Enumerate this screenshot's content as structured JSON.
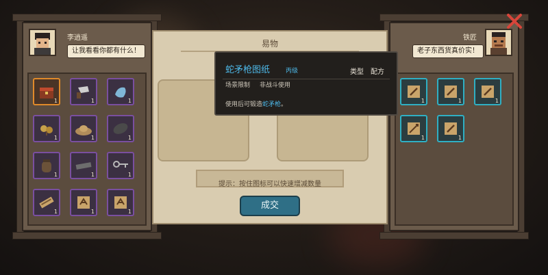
{
  "title": "易物",
  "left_npc": {
    "name": "李逍遥",
    "speech": "让我看看你都有什么！",
    "items": [
      {
        "icon": "treasure-chest-icon",
        "qty": "1",
        "rarity": "orange"
      },
      {
        "icon": "cleaver-icon",
        "qty": "1",
        "rarity": "purple"
      },
      {
        "icon": "blue-cloth-icon",
        "qty": "1",
        "rarity": "purple"
      },
      {
        "icon": "herb-icon",
        "qty": "1",
        "rarity": "purple"
      },
      {
        "icon": "straw-hat-icon",
        "qty": "1",
        "rarity": "purple"
      },
      {
        "icon": "black-leaf-icon",
        "qty": "1",
        "rarity": "purple"
      },
      {
        "icon": "jar-icon",
        "qty": "1",
        "rarity": "purple"
      },
      {
        "icon": "iron-bar-icon",
        "qty": "1",
        "rarity": "purple"
      },
      {
        "icon": "key-icon",
        "qty": "1",
        "rarity": "purple"
      },
      {
        "icon": "scroll-icon",
        "qty": "1",
        "rarity": "purple"
      },
      {
        "icon": "blueprint-icon",
        "qty": "1",
        "rarity": "purple"
      },
      {
        "icon": "blueprint-icon",
        "qty": "1",
        "rarity": "purple"
      }
    ]
  },
  "right_npc": {
    "name": "铁匠",
    "speech": "老子东西货真价实！",
    "items": [
      {
        "icon": "weapon-recipe-icon",
        "qty": "1",
        "rarity": "teal"
      },
      {
        "icon": "weapon-recipe-icon",
        "qty": "1",
        "rarity": "teal"
      },
      {
        "icon": "weapon-recipe-icon",
        "qty": "1",
        "rarity": "teal"
      },
      {
        "icon": "spear-recipe-icon",
        "qty": "1",
        "rarity": "teal"
      },
      {
        "icon": "weapon-recipe-icon",
        "qty": "1",
        "rarity": "teal"
      }
    ]
  },
  "center": {
    "hint": "提示：按住图标可以快速增减数量",
    "deal_label": "成交"
  },
  "tooltip": {
    "name": "蛇矛枪图纸",
    "grade": "丙级",
    "type_label": "类型",
    "type_value": "配方",
    "limit_label": "场景限制",
    "limit_value": "非战斗使用",
    "desc_prefix": "使用后可锻造",
    "desc_highlight": "蛇矛枪",
    "desc_suffix": "。"
  },
  "colors": {
    "accent_blue": "#4db8e8",
    "rarity_purple": "#7a4fa0",
    "rarity_orange": "#e08a2a",
    "rarity_teal": "#2fb0c4",
    "close_red": "#d8453a"
  }
}
